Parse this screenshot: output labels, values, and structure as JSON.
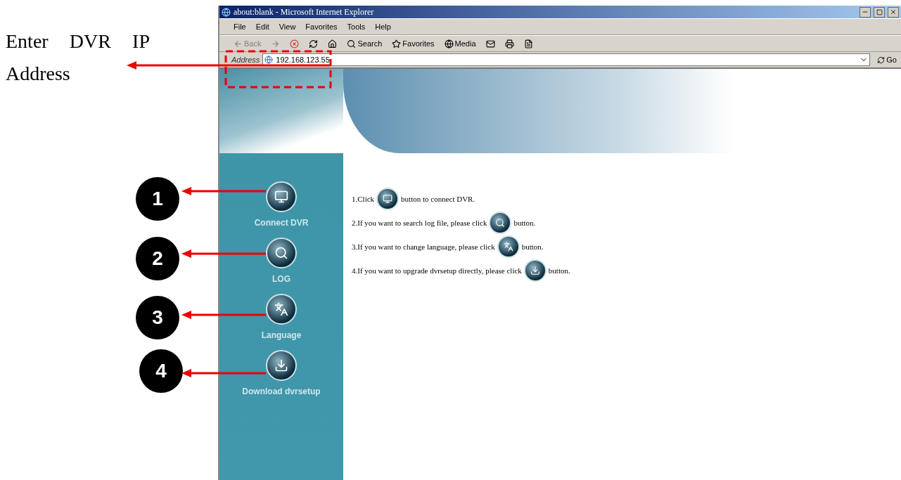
{
  "annotation": {
    "text": "Enter DVR IP Address"
  },
  "callouts": [
    "1",
    "2",
    "3",
    "4"
  ],
  "window": {
    "title": "about:blank - Microsoft Internet Explorer"
  },
  "menu": [
    "File",
    "Edit",
    "View",
    "Favorites",
    "Tools",
    "Help"
  ],
  "toolbar": [
    {
      "label": "Back",
      "disabled": true
    },
    {
      "label": "Search",
      "disabled": false
    },
    {
      "label": "Favorites",
      "disabled": false
    },
    {
      "label": "Media",
      "disabled": false
    }
  ],
  "address": {
    "label": "Address",
    "value": "192.168.123.55",
    "go": "Go"
  },
  "sidebar": {
    "items": [
      {
        "kind": "monitor",
        "label": "Connect DVR"
      },
      {
        "kind": "search",
        "label": "LOG"
      },
      {
        "kind": "language",
        "label": "Language"
      },
      {
        "kind": "download",
        "label": "Download dvrsetup"
      }
    ]
  },
  "instructions": [
    {
      "kind": "monitor",
      "before": "1.Click",
      "after": "button to connect DVR."
    },
    {
      "kind": "search",
      "before": "2.If you want to search log file, please click",
      "after": "button."
    },
    {
      "kind": "language",
      "before": "3.If you want to change language, please click",
      "after": "button."
    },
    {
      "kind": "download",
      "before": "4.If you want to upgrade dvrsetup directly, please click",
      "after": "button."
    }
  ]
}
